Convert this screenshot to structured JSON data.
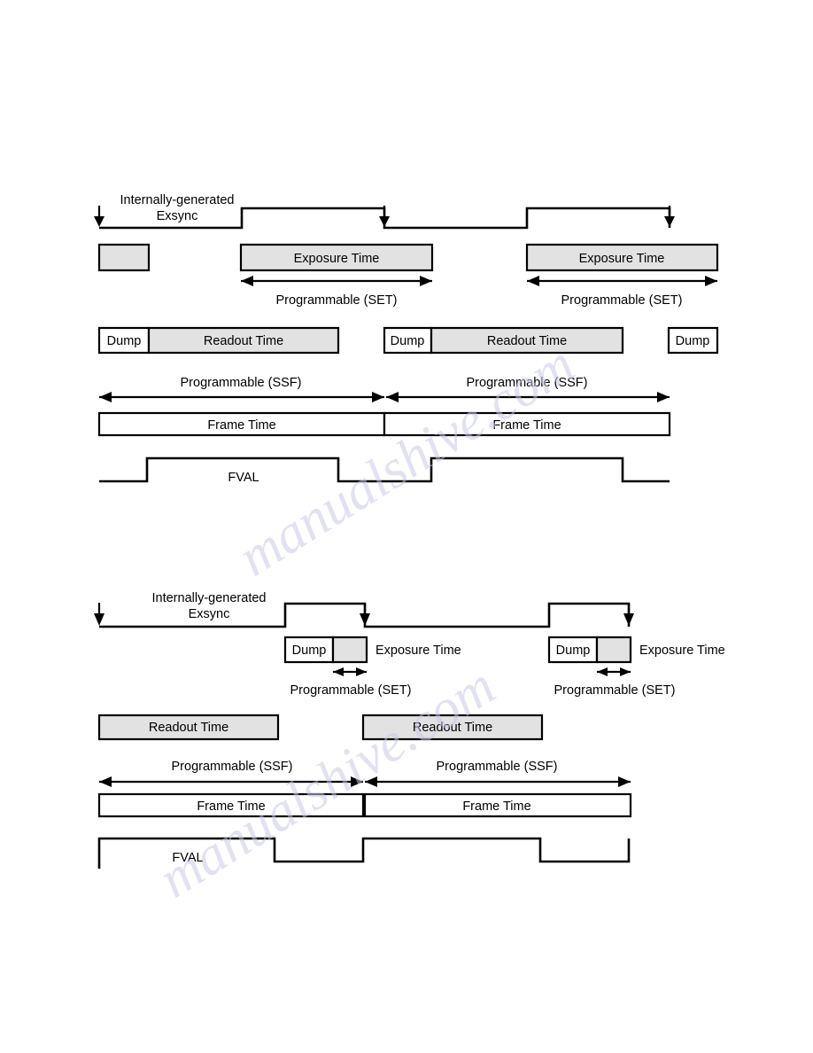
{
  "document": {
    "watermark_text": "manualshive.com",
    "background": "#ffffff",
    "box_fill_gray": "#e2e2e2",
    "box_fill_white": "#ffffff",
    "line_color": "#000000"
  },
  "diagrams": [
    {
      "id": "diagram-one",
      "name": "exposure-after-exsync-timing",
      "signal_label_line1": "Internally-generated",
      "signal_label_line2": "Exsync",
      "exposure_boxes": [
        {
          "label": "",
          "fill": "gray"
        },
        {
          "label": "Exposure Time",
          "fill": "gray"
        },
        {
          "label": "Exposure Time",
          "fill": "gray"
        }
      ],
      "set_arrows": [
        {
          "label": "Programmable (SET)"
        },
        {
          "label": "Programmable (SET)"
        }
      ],
      "readout_groups": [
        {
          "dump_label": "Dump",
          "readout_label": "Readout Time"
        },
        {
          "dump_label": "Dump",
          "readout_label": "Readout Time"
        },
        {
          "dump_label": "Dump",
          "readout_label": ""
        }
      ],
      "ssf_arrows": [
        {
          "label": "Programmable (SSF)"
        },
        {
          "label": "Programmable (SSF)"
        }
      ],
      "frame_boxes": [
        {
          "label": "Frame Time"
        },
        {
          "label": "Frame Time"
        }
      ],
      "fval_label": "FVAL"
    },
    {
      "id": "diagram-two",
      "name": "dump-then-exposure-timing",
      "signal_label_line1": "Internally-generated",
      "signal_label_line2": "Exsync",
      "dump_groups": [
        {
          "dump_label": "Dump",
          "exposure_label": "Exposure Time"
        },
        {
          "dump_label": "Dump",
          "exposure_label": "Exposure Time"
        }
      ],
      "set_arrows": [
        {
          "label": "Programmable (SET)"
        },
        {
          "label": "Programmable (SET)"
        }
      ],
      "readout_boxes": [
        {
          "label": "Readout Time"
        },
        {
          "label": "Readout Time"
        }
      ],
      "ssf_arrows": [
        {
          "label": "Programmable (SSF)"
        },
        {
          "label": "Programmable (SSF)"
        }
      ],
      "frame_boxes": [
        {
          "label": "Frame Time"
        },
        {
          "label": "Frame Time"
        }
      ],
      "fval_label": "FVAL"
    }
  ]
}
